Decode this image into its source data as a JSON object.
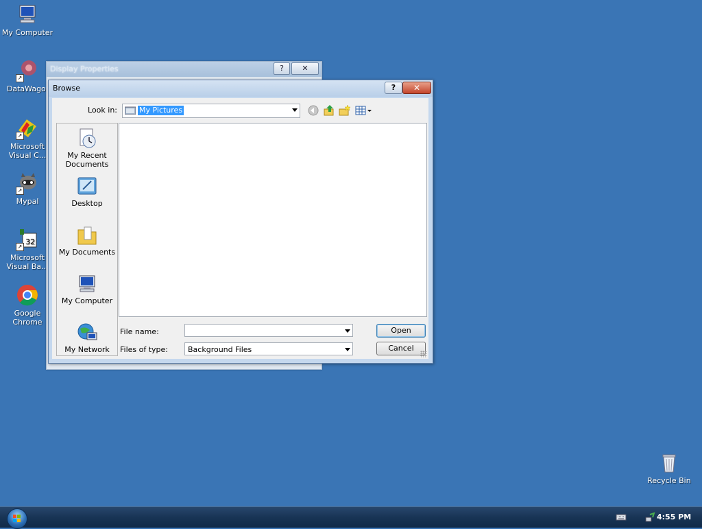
{
  "desktop": {
    "icons": [
      {
        "label": "My Computer",
        "icon": "computer-icon"
      },
      {
        "label": "DataWago.",
        "icon": "datawago-icon"
      },
      {
        "label": "Microsoft Visual C...",
        "icon": "visual-c-icon"
      },
      {
        "label": "Mypal",
        "icon": "mypal-icon"
      },
      {
        "label": "Microsoft Visual Ba...",
        "icon": "visual-basic-icon"
      },
      {
        "label": "Google Chrome",
        "icon": "chrome-icon"
      },
      {
        "label": "Recycle Bin",
        "icon": "recycle-bin-icon"
      }
    ]
  },
  "background_window": {
    "title": "Display Properties",
    "help_label": "?",
    "close_label": "✕"
  },
  "dialog": {
    "title": "Browse",
    "help_label": "?",
    "close_label": "✕",
    "look_in_label": "Look in:",
    "look_in_value": "My Pictures",
    "places": [
      {
        "label": "My Recent Documents",
        "icon": "recent-documents-icon"
      },
      {
        "label": "Desktop",
        "icon": "desktop-icon"
      },
      {
        "label": "My Documents",
        "icon": "my-documents-icon"
      },
      {
        "label": "My Computer",
        "icon": "my-computer-icon"
      },
      {
        "label": "My Network",
        "icon": "my-network-icon"
      }
    ],
    "file_name_label": "File name:",
    "file_name_value": "",
    "files_of_type_label": "Files of type:",
    "files_of_type_value": "Background Files",
    "open_label": "Open",
    "cancel_label": "Cancel",
    "toolbar_icons": [
      "back-icon",
      "up-folder-icon",
      "new-folder-icon",
      "view-menu-icon"
    ]
  },
  "taskbar": {
    "clock": "4:55 PM",
    "tray_icons": [
      "keyboard-icon",
      "network-tray-icon"
    ]
  }
}
